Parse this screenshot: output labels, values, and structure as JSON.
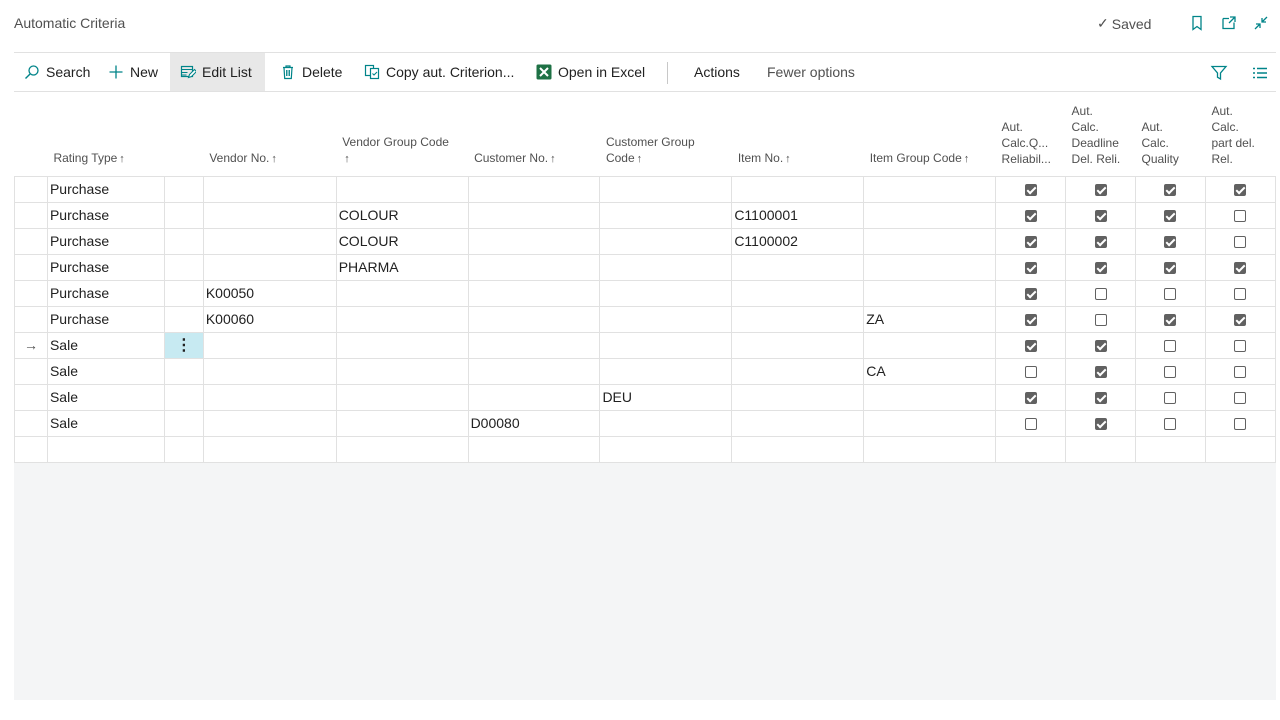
{
  "page": {
    "title": "Automatic Criteria",
    "saved_label": "Saved",
    "saved_check": "✓"
  },
  "toolbar": {
    "search": "Search",
    "new": "New",
    "edit_list": "Edit List",
    "delete": "Delete",
    "copy": "Copy aut. Criterion...",
    "excel": "Open in Excel",
    "actions": "Actions",
    "fewer": "Fewer options"
  },
  "table": {
    "headers": {
      "rating_type": "Rating Type",
      "vendor_no": "Vendor No.",
      "vendor_group_1": "Vendor Group Code",
      "customer_no": "Customer No.",
      "customer_group_1": "Customer Group",
      "customer_group_2": "Code",
      "item_no": "Item No.",
      "item_group": "Item Group Code",
      "calc_q_1": "Aut.",
      "calc_q_2": "Calc.Q...",
      "calc_q_3": "Reliabil...",
      "deadline_1": "Aut.",
      "deadline_2": "Calc.",
      "deadline_3": "Deadline",
      "deadline_4": "Del. Reli.",
      "quality_1": "Aut.",
      "quality_2": "Calc.",
      "quality_3": "Quality",
      "partdel_1": "Aut.",
      "partdel_2": "Calc.",
      "partdel_3": "part del.",
      "partdel_4": "Rel.",
      "sort_arrow": "↑"
    },
    "current_row_arrow": "→",
    "row_menu": "⋮",
    "rows": [
      {
        "rating_type": "Purchase",
        "vendor_no": "",
        "vendor_group": "",
        "customer_no": "",
        "customer_group": "",
        "item_no": "",
        "item_group": "",
        "calc_q": true,
        "deadline": true,
        "quality": true,
        "partdel": true
      },
      {
        "rating_type": "Purchase",
        "vendor_no": "",
        "vendor_group": "COLOUR",
        "customer_no": "",
        "customer_group": "",
        "item_no": "C1100001",
        "item_group": "",
        "calc_q": true,
        "deadline": true,
        "quality": true,
        "partdel": false
      },
      {
        "rating_type": "Purchase",
        "vendor_no": "",
        "vendor_group": "COLOUR",
        "customer_no": "",
        "customer_group": "",
        "item_no": "C1100002",
        "item_group": "",
        "calc_q": true,
        "deadline": true,
        "quality": true,
        "partdel": false
      },
      {
        "rating_type": "Purchase",
        "vendor_no": "",
        "vendor_group": "PHARMA",
        "customer_no": "",
        "customer_group": "",
        "item_no": "",
        "item_group": "",
        "calc_q": true,
        "deadline": true,
        "quality": true,
        "partdel": true
      },
      {
        "rating_type": "Purchase",
        "vendor_no": "K00050",
        "vendor_group": "",
        "customer_no": "",
        "customer_group": "",
        "item_no": "",
        "item_group": "",
        "calc_q": true,
        "deadline": false,
        "quality": false,
        "partdel": false
      },
      {
        "rating_type": "Purchase",
        "vendor_no": "K00060",
        "vendor_group": "",
        "customer_no": "",
        "customer_group": "",
        "item_no": "",
        "item_group": "ZA",
        "calc_q": true,
        "deadline": false,
        "quality": true,
        "partdel": true
      },
      {
        "rating_type": "Sale",
        "vendor_no": "",
        "vendor_group": "",
        "customer_no": "",
        "customer_group": "",
        "item_no": "",
        "item_group": "",
        "calc_q": true,
        "deadline": true,
        "quality": false,
        "partdel": false
      },
      {
        "rating_type": "Sale",
        "vendor_no": "",
        "vendor_group": "",
        "customer_no": "",
        "customer_group": "",
        "item_no": "",
        "item_group": "CA",
        "calc_q": false,
        "deadline": true,
        "quality": false,
        "partdel": false
      },
      {
        "rating_type": "Sale",
        "vendor_no": "",
        "vendor_group": "",
        "customer_no": "",
        "customer_group": "DEU",
        "item_no": "",
        "item_group": "",
        "calc_q": true,
        "deadline": true,
        "quality": false,
        "partdel": false
      },
      {
        "rating_type": "Sale",
        "vendor_no": "",
        "vendor_group": "",
        "customer_no": "D00080",
        "customer_group": "",
        "item_no": "",
        "item_group": "",
        "calc_q": false,
        "deadline": true,
        "quality": false,
        "partdel": false
      }
    ],
    "current_row_index": 6
  },
  "colors": {
    "accent": "#008489",
    "excel_green": "#1e7145",
    "selected_cell": "#c7eaf2",
    "grid_background": "#f4f5f6"
  }
}
